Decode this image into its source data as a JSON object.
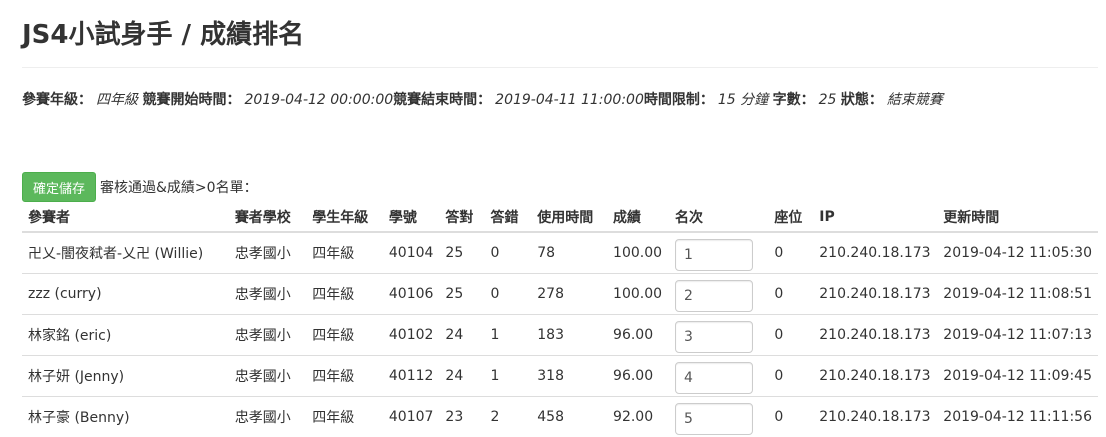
{
  "page": {
    "title": "JS4小試身手 / 成績排名"
  },
  "info": {
    "grade_label": "參賽年級：",
    "grade_value": "四年級",
    "start_label": "競賽開始時間：",
    "start_value": "2019-04-12 00:00:00",
    "end_label": "競賽結束時間：",
    "end_value": "2019-04-11 11:00:00",
    "limit_label": "時間限制：",
    "limit_value": "15 分鐘",
    "words_label": "字數：",
    "words_value": "25",
    "status_label": "狀態：",
    "status_value": "結束競賽"
  },
  "toolbar": {
    "save_label": "確定儲存",
    "note": "審核通過&成績>0名單："
  },
  "table": {
    "headers": [
      "參賽者",
      "賽者學校",
      "學生年級",
      "學號",
      "答對",
      "答錯",
      "使用時間",
      "成績",
      "名次",
      "座位",
      "IP",
      "更新時間"
    ],
    "rows": [
      {
        "name": "卍乂-闇夜弒者-乂卍 (Willie)",
        "school": "忠孝國小",
        "grade": "四年級",
        "student_id": "40104",
        "correct": "25",
        "wrong": "0",
        "time_used": "78",
        "score": "100.00",
        "rank": "1",
        "seat": "0",
        "ip": "210.240.18.173",
        "updated": "2019-04-12 11:05:30"
      },
      {
        "name": "zzz (curry)",
        "school": "忠孝國小",
        "grade": "四年級",
        "student_id": "40106",
        "correct": "25",
        "wrong": "0",
        "time_used": "278",
        "score": "100.00",
        "rank": "2",
        "seat": "0",
        "ip": "210.240.18.173",
        "updated": "2019-04-12 11:08:51"
      },
      {
        "name": "林家銘 (eric)",
        "school": "忠孝國小",
        "grade": "四年級",
        "student_id": "40102",
        "correct": "24",
        "wrong": "1",
        "time_used": "183",
        "score": "96.00",
        "rank": "3",
        "seat": "0",
        "ip": "210.240.18.173",
        "updated": "2019-04-12 11:07:13"
      },
      {
        "name": "林子妍 (Jenny)",
        "school": "忠孝國小",
        "grade": "四年級",
        "student_id": "40112",
        "correct": "24",
        "wrong": "1",
        "time_used": "318",
        "score": "96.00",
        "rank": "4",
        "seat": "0",
        "ip": "210.240.18.173",
        "updated": "2019-04-12 11:09:45"
      },
      {
        "name": "林子豪 (Benny)",
        "school": "忠孝國小",
        "grade": "四年級",
        "student_id": "40107",
        "correct": "23",
        "wrong": "2",
        "time_used": "458",
        "score": "92.00",
        "rank": "5",
        "seat": "0",
        "ip": "210.240.18.173",
        "updated": "2019-04-12 11:11:56"
      }
    ]
  },
  "colors": {
    "save_button": "#5cb85c",
    "border": "#dddddd"
  }
}
